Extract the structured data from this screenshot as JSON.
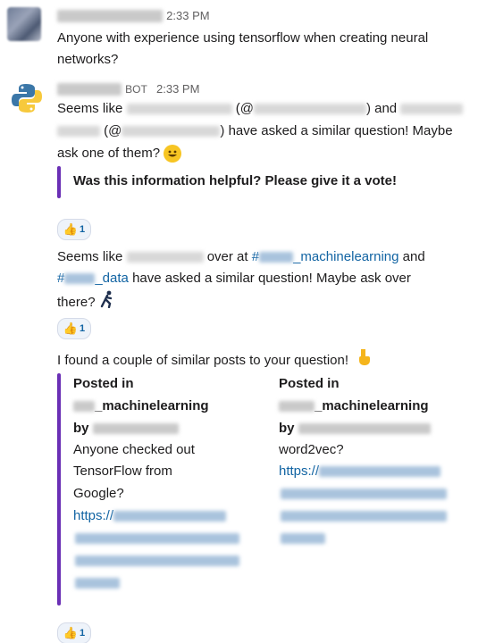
{
  "messages": [
    {
      "time": "2:33 PM",
      "text": "Anyone with experience using tensorflow when creating neural",
      "text2": "networks?"
    },
    {
      "bot_badge": "BOT",
      "time": "2:33 PM",
      "l1_a": "Seems like",
      "l1_b": "(@",
      "l1_c": ") and",
      "l2_a": "(@",
      "l2_b": ") have asked a similar question! Maybe",
      "l3_a": "ask one of them?",
      "attachment_title": "Was this information helpful? Please give it a vote!",
      "reaction_count": "1"
    },
    {
      "l1_a": "Seems like",
      "l1_b": "over at",
      "l1_channel": "#",
      "l1_channel_suffix": "_machinelearning",
      "l1_c": "and",
      "l2_channel": "#",
      "l2_channel_suffix": "_data",
      "l2_b": "have asked a similar question! Maybe ask over",
      "l3": "there?",
      "reaction_count": "1"
    },
    {
      "intro": "I found a couple of similar posts to your question!",
      "posts": [
        {
          "posted_in": "Posted in",
          "channel_suffix": "_machinelearning",
          "by": "by",
          "text_lines": [
            "Anyone checked out",
            "TensorFlow from",
            "Google?"
          ],
          "link": "https://"
        },
        {
          "posted_in": "Posted in",
          "channel_suffix": "_machinelearning",
          "by": "by",
          "text_lines": [
            "word2vec?"
          ],
          "link": "https://"
        }
      ],
      "reaction_count": "1"
    }
  ],
  "colors": {
    "link": "#1264a3",
    "attachment_bar": "#6a2fb5",
    "reaction_bg": "#eef3fa"
  },
  "icons": {
    "reaction": "thumbs-up-icon",
    "emoji_smile": "smiley-emoji-icon",
    "emoji_runner": "running-figure-emoji-icon",
    "emoji_point": "point-down-emoji-icon"
  }
}
